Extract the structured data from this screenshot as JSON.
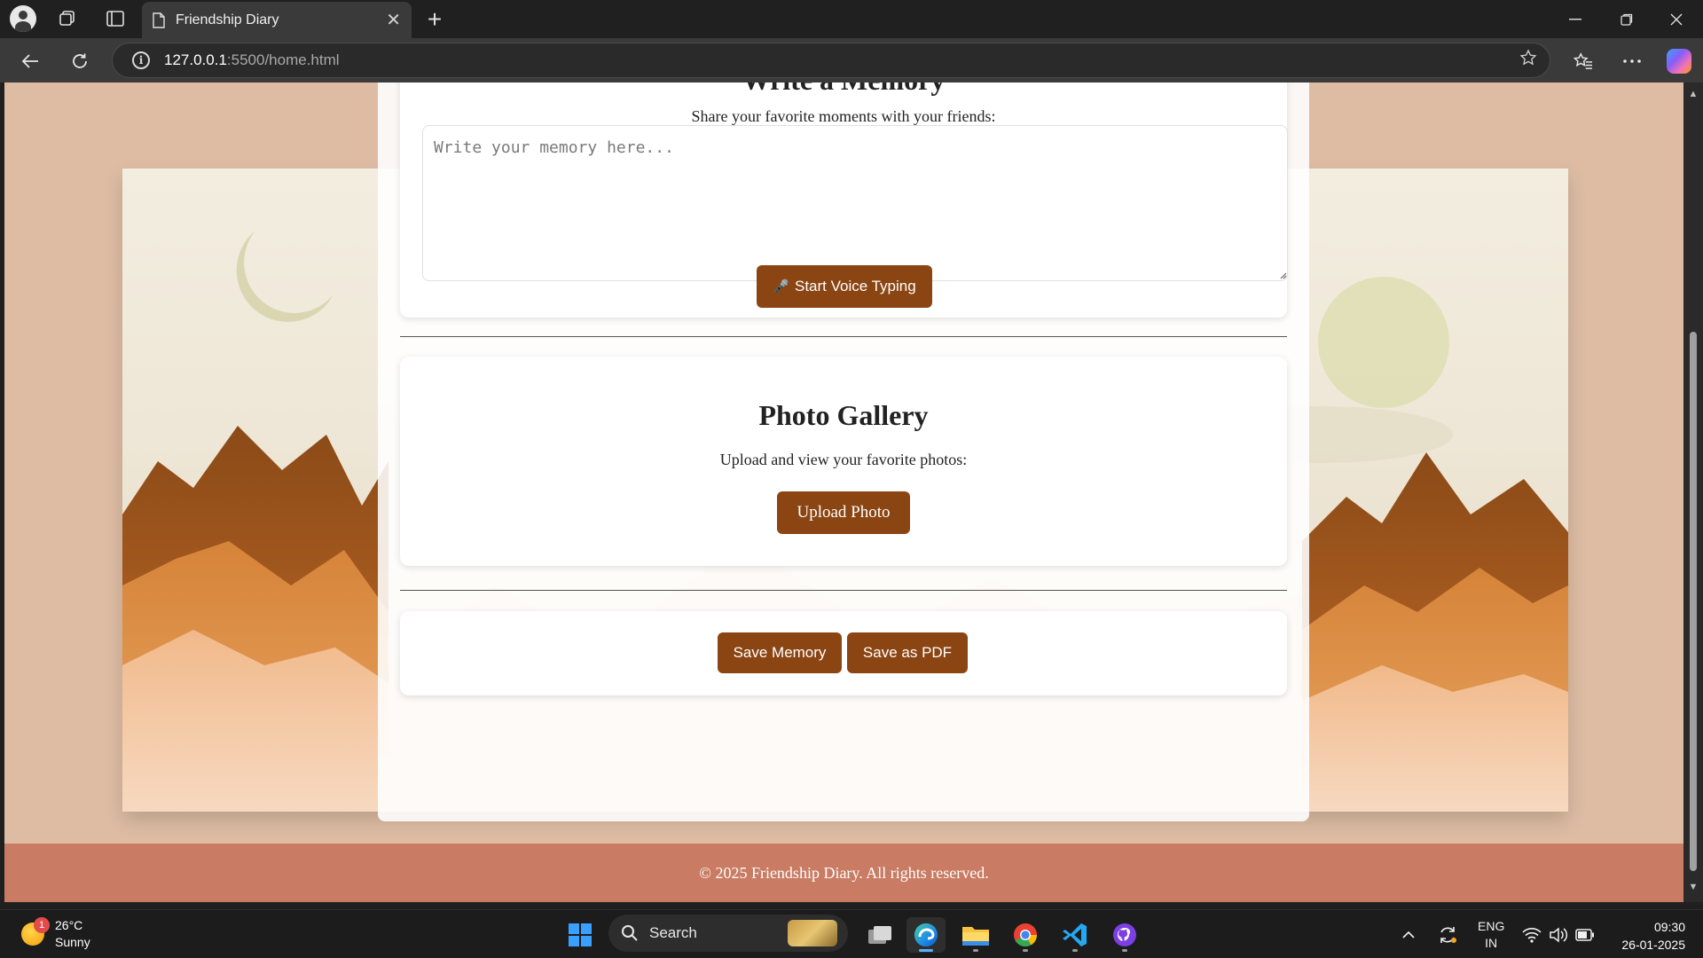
{
  "browser": {
    "tab_title": "Friendship Diary",
    "url_host": "127.0.0.1",
    "url_rest": ":5500/home.html",
    "close_tab": "✕",
    "new_tab": "+"
  },
  "memory_section": {
    "heading": "Write a Memory",
    "subtitle": "Share your favorite moments with your friends:",
    "textarea_placeholder": "Write your memory here...",
    "voice_button_icon": "🎤",
    "voice_button": "Start Voice Typing"
  },
  "gallery_section": {
    "heading": "Photo Gallery",
    "subtitle": "Upload and view your favorite photos:",
    "upload_button": "Upload Photo"
  },
  "actions": {
    "save_memory": "Save Memory",
    "save_pdf": "Save as PDF"
  },
  "footer": {
    "text": "© 2025 Friendship Diary. All rights reserved."
  },
  "taskbar": {
    "weather_badge": "1",
    "temperature": "26°C",
    "condition": "Sunny",
    "search_label": "Search",
    "language_top": "ENG",
    "language_bottom": "IN",
    "time": "09:30",
    "date": "26-01-2025"
  },
  "icons": {
    "window_controls": [
      "minimize-icon",
      "restore-icon",
      "close-icon"
    ],
    "toolbar": [
      "back-icon",
      "refresh-icon",
      "info-icon",
      "favorite-star-icon",
      "favorites-icon",
      "more-icon",
      "copilot-icon"
    ]
  },
  "colors": {
    "button_brown": "#8b4513",
    "page_background": "#ddbca3",
    "footer": "#c97b63"
  }
}
